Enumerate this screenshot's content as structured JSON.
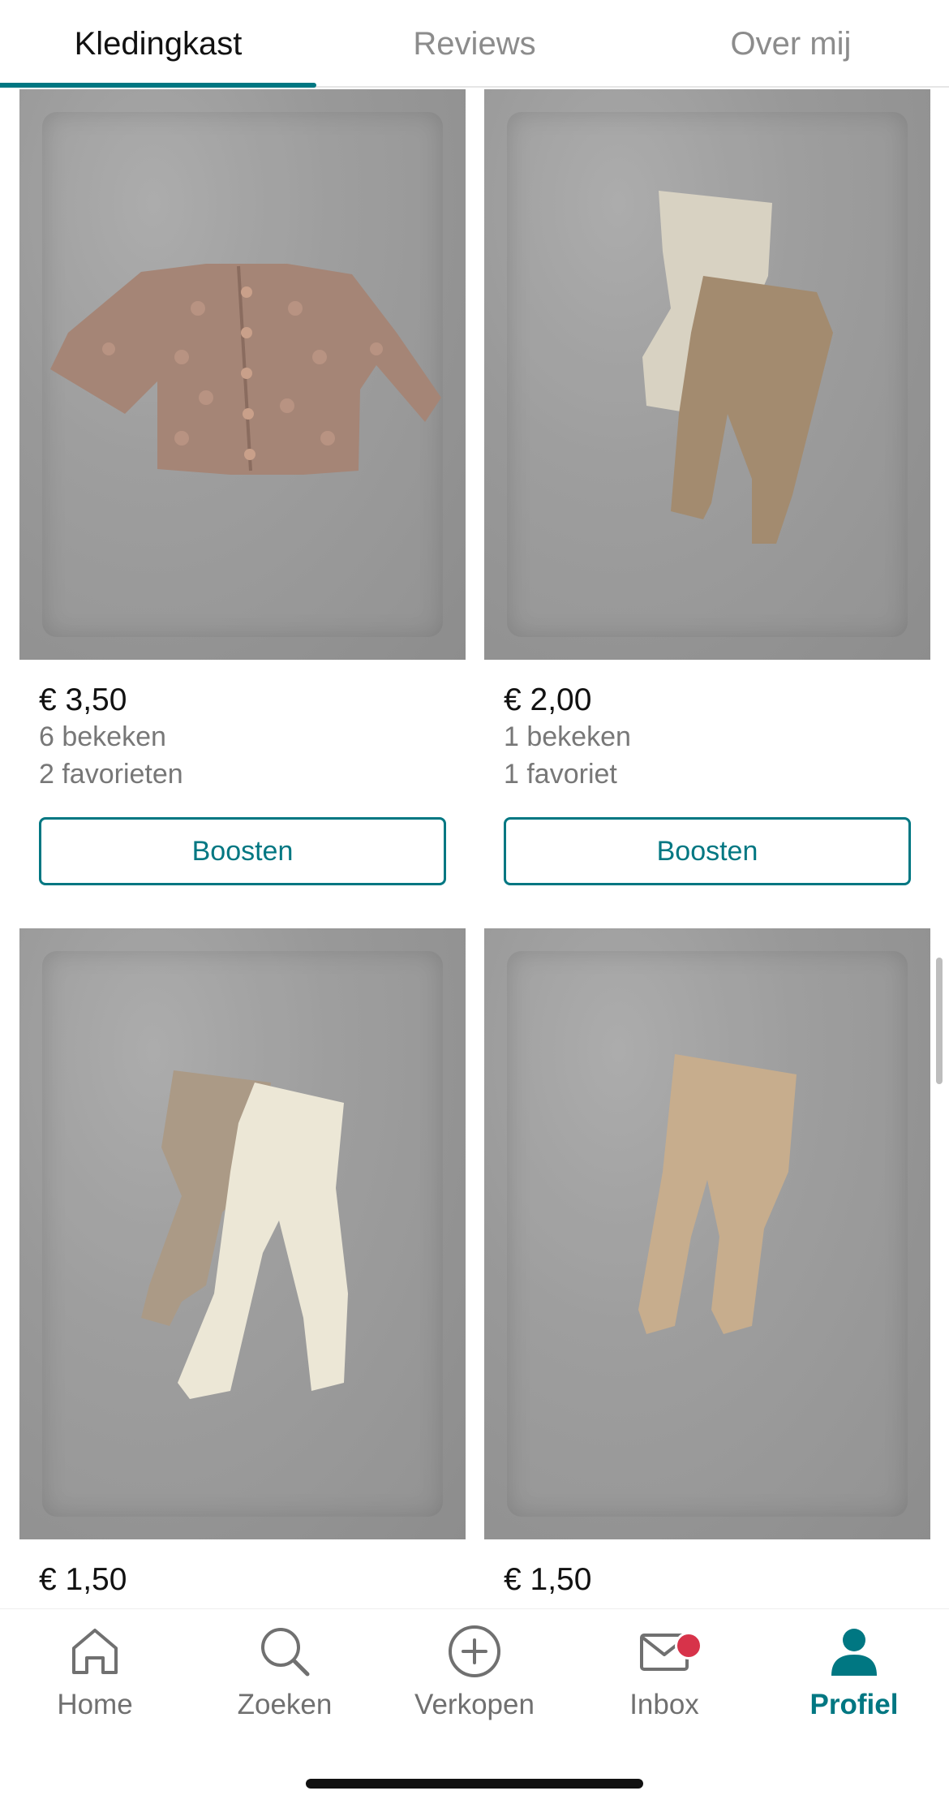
{
  "tabs": [
    {
      "label": "Kledingkast"
    },
    {
      "label": "Reviews"
    },
    {
      "label": "Over mij"
    }
  ],
  "items": [
    {
      "price": "€ 3,50",
      "views": "6 bekeken",
      "favorites": "2 favorieten",
      "button": "Boosten",
      "image": "knit-cardigan"
    },
    {
      "price": "€ 2,00",
      "views": "1 bekeken",
      "favorites": "1 favoriet",
      "button": "Boosten",
      "image": "two-tights"
    },
    {
      "price": "€ 1,50",
      "image": "two-tights-cream"
    },
    {
      "price": "€ 1,50",
      "image": "beige-tights"
    }
  ],
  "nav": [
    {
      "label": "Home",
      "icon": "home-icon"
    },
    {
      "label": "Zoeken",
      "icon": "search-icon"
    },
    {
      "label": "Verkopen",
      "icon": "plus-circle-icon"
    },
    {
      "label": "Inbox",
      "icon": "mail-icon"
    },
    {
      "label": "Profiel",
      "icon": "profile-icon"
    }
  ],
  "colors": {
    "accent": "#007782",
    "badge": "#d7334a"
  }
}
